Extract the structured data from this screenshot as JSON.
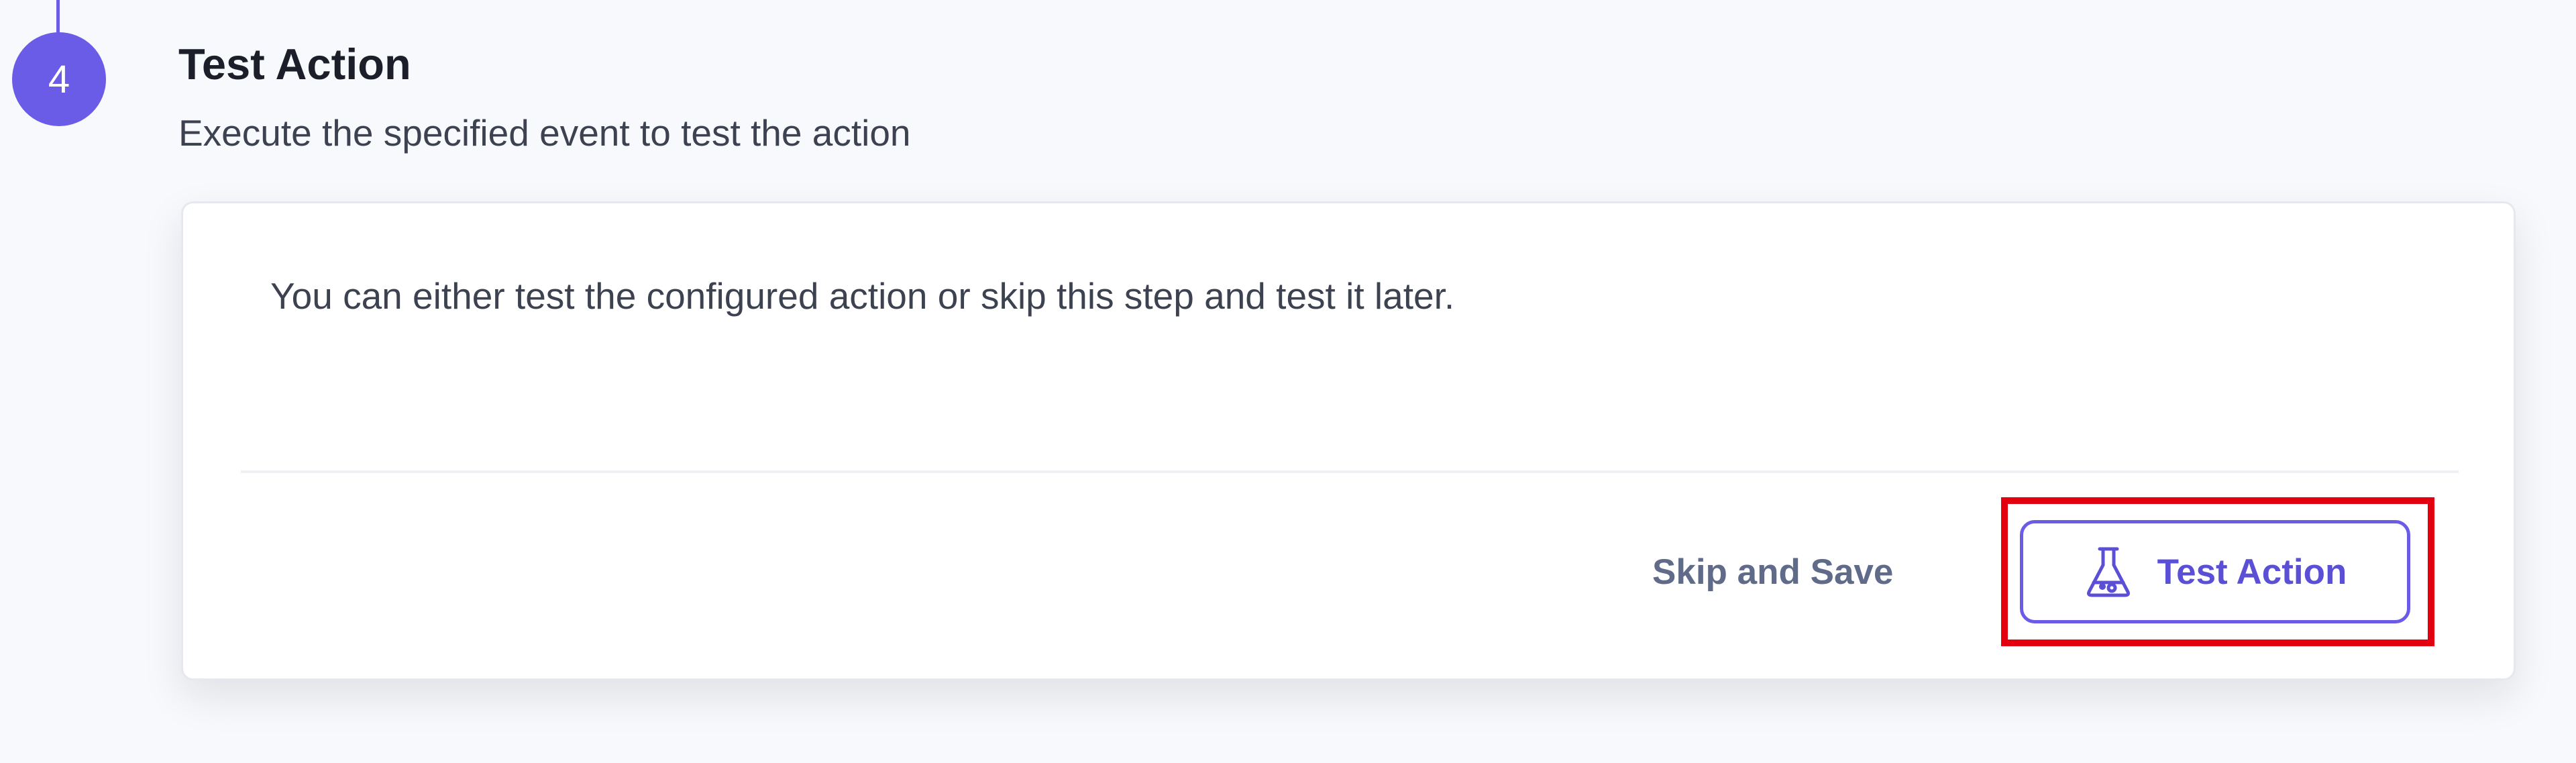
{
  "step": {
    "number": "4",
    "title": "Test Action",
    "subtitle": "Execute the specified event to test the action"
  },
  "card": {
    "message": "You can either test the configured action or skip this step and test it later.",
    "skip_label": "Skip and Save",
    "test_label": "Test Action",
    "test_icon": "flask-icon"
  },
  "colors": {
    "accent": "#6b5ce7",
    "highlight": "#e3000f",
    "background": "#f8f9fc"
  }
}
